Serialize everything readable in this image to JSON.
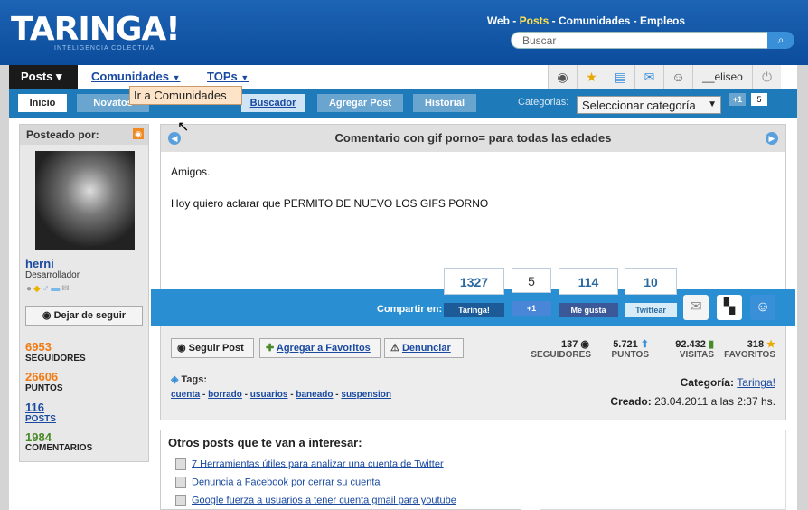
{
  "header": {
    "logo": "TARINGA!",
    "logo_sub": "INTELIGENCIA COLECTIVA",
    "toplinks": {
      "web": "Web",
      "sep": " - ",
      "posts": "Posts",
      "comunidades": "Comunidades",
      "empleos": "Empleos"
    },
    "search_placeholder": "Buscar"
  },
  "nav": {
    "posts": "Posts ▾",
    "comunidades": "Comunidades",
    "tops": "TOPs",
    "username": "__eliseo"
  },
  "subnav": {
    "inicio": "Inicio",
    "novatos": "Novatos",
    "buscador": "Buscador",
    "agregar": "Agregar Post",
    "historial": "Historial",
    "categorias_label": "Categorias:",
    "categoria_select": "Seleccionar categoría",
    "plus_one": "+1",
    "plus_count": "5"
  },
  "tooltip": "Ir a Comunidades",
  "author": {
    "posteado_por": "Posteado por:",
    "name": "herni",
    "role": "Desarrollador",
    "unfollow": "Dejar de seguir",
    "stats": [
      {
        "value": "6953",
        "label": "SEGUIDORES",
        "color": "#f07a14"
      },
      {
        "value": "26606",
        "label": "PUNTOS",
        "color": "#f07a14"
      },
      {
        "value": "116",
        "label": "POSTS",
        "color": "#1a4aa0"
      },
      {
        "value": "1984",
        "label": "COMENTARIOS",
        "color": "#4a8a2a"
      }
    ]
  },
  "post": {
    "title": "Comentario con gif porno= para todas las edades",
    "body_line1": "Amigos.",
    "body_line2": "Hoy quiero aclarar que PERMITO DE NUEVO LOS GIFS PORNO",
    "compartir": "Compartir en:",
    "shares": [
      {
        "count": "1327",
        "button": "Taringa!"
      },
      {
        "count": "5",
        "button": "+1"
      },
      {
        "count": "114",
        "button": "Me gusta"
      },
      {
        "count": "10",
        "button": "Twittear"
      }
    ],
    "actions": {
      "seguir": "Seguir Post",
      "favoritos": "Agregar a Favoritos",
      "denunciar": "Denunciar"
    },
    "pstats": [
      {
        "value": "137",
        "label": "SEGUIDORES"
      },
      {
        "value": "5.721",
        "label": "PUNTOS"
      },
      {
        "value": "92.432",
        "label": "VISITAS"
      },
      {
        "value": "318",
        "label": "FAVORITOS"
      }
    ],
    "tags_label": "Tags:",
    "tags": [
      "cuenta",
      "borrado",
      "usuarios",
      "baneado",
      "suspension"
    ],
    "categoria_label": "Categoría:",
    "categoria": "Taringa!",
    "creado_label": "Creado:",
    "creado": "23.04.2011 a las 2:37 hs."
  },
  "related": {
    "title": "Otros posts que te van a interesar:",
    "items": [
      "7 Herramientas útiles para analizar una cuenta de Twitter",
      "Denuncia a Facebook por cerrar su cuenta",
      "Google fuerza a usuarios a tener cuenta gmail para youtube"
    ]
  }
}
